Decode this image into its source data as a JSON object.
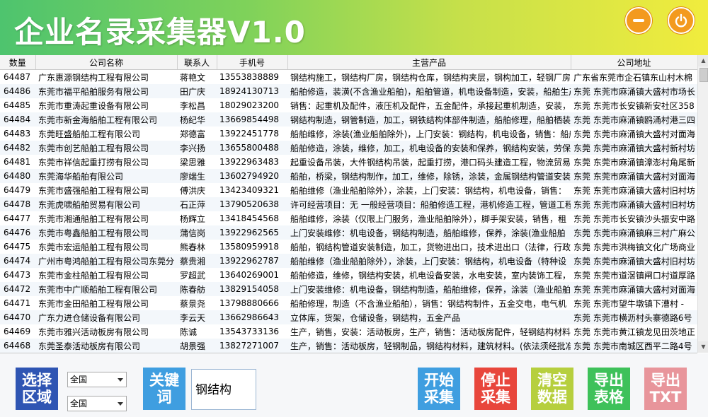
{
  "app": {
    "title": "企业名录采集器V1.0"
  },
  "columns": [
    "数量",
    "公司名称",
    "联系人",
    "手机号",
    "主营产品",
    "公司地址"
  ],
  "rows": [
    [
      "64487",
      "广东惠源钢结构工程有限公司",
      "蒋艳文",
      "13553838889",
      "钢结构施工，钢结构厂房，钢结构仓库，钢结构夹层，钢构加工，轻钢厂房",
      "广东省东莞市企石镇东山村木棉"
    ],
    [
      "64486",
      "东莞市福平船舶服务有限公司",
      "田广庆",
      "18924130713",
      "船舶修造，装潢(不含渔业船舶)，船舶管道，机电设备制造，安装，船舶生产",
      "东莞 东莞市麻涌镇大盛村市场长"
    ],
    [
      "64485",
      "东莞市重涛起重设备有限公司",
      "李松昌",
      "18029023200",
      "销售：起重机及配件，液压机及配件，五金配件，承接起重机制造，安装，维",
      "东莞 东莞市长安镇新安社区358"
    ],
    [
      "64484",
      "东莞市新金海船舶工程有限公司",
      "杨纪华",
      "13669854498",
      "钢结构制造，钢管制造，加工，钢铁结构体部件制造，船舶修理，船舶栖装",
      "东莞 东莞市麻涌镇鸥涌村港三四"
    ],
    [
      "64483",
      "东莞旺盛船舶工程有限公司",
      "郑德富",
      "13922451778",
      "船舶维修，涂装(渔业船舶除外)，上门安装：钢结构，机电设备，销售：船舶",
      "东莞 东莞市麻涌镇大盛村对面海"
    ],
    [
      "64482",
      "东莞市创艺船舶工程有限公司",
      "李兴扬",
      "13655800488",
      "船舶修造，涂装，维修，加工，机电设备的安装和保养，钢结构安装，劳保用",
      "东莞 东莞市麻涌镇大盛村新村坊"
    ],
    [
      "64481",
      "东莞市祥信起重打捞有限公司",
      "梁思雅",
      "13922963483",
      "起重设备吊装，大件钢结构吊装，起重打捞，港口码头建造工程，物流贸易",
      "东莞 东莞市麻涌镇漳澎村角尾新"
    ],
    [
      "64480",
      "东莞海华船舶有限公司",
      "廖端生",
      "13602794920",
      "船舶，桥梁，钢结构制作，加工，维修，除锈，涂装，金属钢结构管道安装",
      "东莞 东莞市麻涌镇大盛村对面海"
    ],
    [
      "64479",
      "东莞市盛强船舶工程有限公司",
      "傅洪庆",
      "13423409321",
      "船舶维修（渔业船舶除外），涂装，上门安装：钢结构，机电设备，销售：",
      "东莞 东莞市麻涌镇大盛村旧村坊"
    ],
    [
      "64478",
      "东莞虎啸船舶贸易有限公司",
      "石正萍",
      "13790520638",
      "许可经营项目：无 一般经营项目：船舶修造工程，港机修造工程，管道工程",
      "东莞 东莞市麻涌镇大盛村旧村坊"
    ],
    [
      "64477",
      "东莞市湘通船舶工程有限公司",
      "杨辉立",
      "13418454568",
      "船舶维修，涂装（仅限上门服务，渔业船舶除外），脚手架安装，销售，租",
      "东莞 东莞市长安镇沙头振安中路"
    ],
    [
      "64476",
      "东莞市粤鑫船舶工程有限公司",
      "蒲信岗",
      "13922962565",
      "上门安装维修：机电设备，钢结构制造，船舶维修，保养，涂装(渔业船舶",
      "东莞 东莞市麻涌镇麻三村广麻公"
    ],
    [
      "64475",
      "东莞市宏运船舶工程有限公司",
      "熊春林",
      "13580959918",
      "船舶，钢结构管道安装制造，加工，货物进出口，技术进出口（法律，行政",
      "东莞 东莞市洪梅镇文化广场商业"
    ],
    [
      "64474",
      "广州市粤鸿船舶工程有限公司东莞分",
      "蔡贵湘",
      "13922962787",
      "船舶维修（渔业船舶除外），涂装，上门安装：钢结构，机电设备（特种设",
      "东莞 东莞市麻涌镇大盛村旧村坊"
    ],
    [
      "64473",
      "东莞市金柱船舶工程有限公司",
      "罗超武",
      "13640269001",
      "船舶修造，维修，钢结构安装，机电设备安装，水电安装，室内装饰工程，钢",
      "东莞 东莞市道滘镇闸口村道厚路"
    ],
    [
      "64472",
      "东莞市中广顺船舶工程有限公司",
      "陈春舫",
      "13829154058",
      "上门安装维修：机电设备，钢结构制造，船舶维修，保养，涂装（渔业船舶",
      "东莞 东莞市麻涌镇大盛村对面海"
    ],
    [
      "64471",
      "东莞市金田船舶工程有限公司",
      "蔡景尧",
      "13798880666",
      "船舶修理，制造（不含渔业船舶），销售：钢结构制件，五金交电，电气机",
      "东莞 东莞市望牛墩镇下漕村 -"
    ],
    [
      "64470",
      "广东力进仓储设备有限公司",
      "李云天",
      "13662986643",
      "立体库，货架，仓储设备，钢结构，五金产品",
      "东莞 东莞市横沥村头寨德路6号"
    ],
    [
      "64469",
      "东莞市雅兴活动板房有限公司",
      "陈诚",
      "13543733136",
      "生产，销售，安装：活动板房，生产，销售：活动板房配件，轻钢结构材料",
      "东莞 东莞市黄江镇龙见田茨地正"
    ],
    [
      "64468",
      "东莞圣泰活动板房有限公司",
      "胡景强",
      "13827271007",
      "生产，销售：活动板房，轻钢制品，钢结构材料，建筑材料。(依法须经批准",
      "东莞 东莞市南城区西平二路4号"
    ]
  ],
  "controls": {
    "region_button": "选择\n区域",
    "province_select": "全国",
    "city_select": "全国",
    "keyword_button": "关键\n词",
    "keyword_value": "钢结构",
    "start_button": "开始\n采集",
    "stop_button": "停止\n采集",
    "clear_button": "清空\n数据",
    "export_table_button": "导出\n表格",
    "export_txt_button": "导出\nTXT"
  },
  "colors": {
    "region_btn": "#2f55b3",
    "keyword_btn": "#3f9ee0",
    "start_btn": "#3f9ee0",
    "stop_btn": "#e8463c",
    "clear_btn": "#b6cf3e",
    "export_table_btn": "#3ec15a",
    "export_txt_btn": "#e8959b",
    "window_button": "#f39a1e"
  },
  "icons": {
    "minimize": "minus-icon",
    "close": "power-icon"
  }
}
